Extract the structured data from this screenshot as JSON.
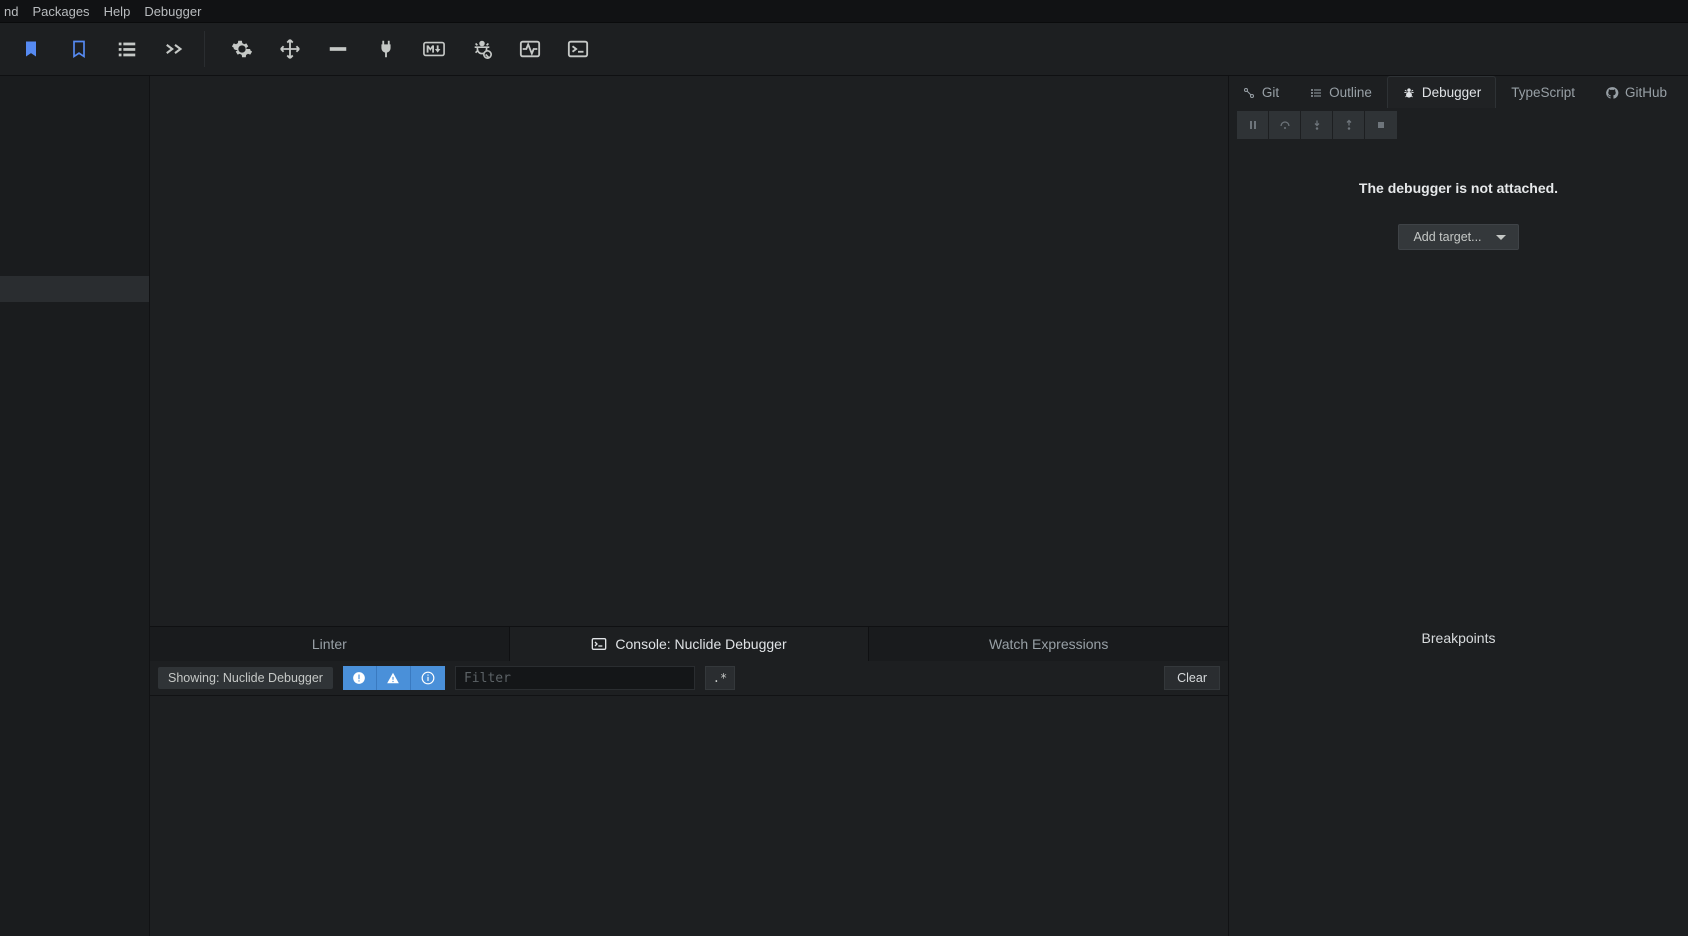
{
  "menubar": {
    "items": [
      "nd",
      "Packages",
      "Help",
      "Debugger"
    ]
  },
  "right_panel": {
    "tabs": [
      {
        "label": "Git",
        "active": false
      },
      {
        "label": "Outline",
        "active": false
      },
      {
        "label": "Debugger",
        "active": true
      },
      {
        "label": "TypeScript",
        "active": false
      },
      {
        "label": "GitHub",
        "active": false
      }
    ],
    "status_message": "The debugger is not attached.",
    "add_target_label": "Add target...",
    "breakpoints_header": "Breakpoints"
  },
  "bottom_panel": {
    "tabs": [
      {
        "label": "Linter",
        "active": false
      },
      {
        "label": "Console: Nuclide Debugger",
        "active": true
      },
      {
        "label": "Watch Expressions",
        "active": false
      }
    ],
    "showing_label": "Showing: Nuclide Debugger",
    "filter_placeholder": "Filter",
    "regex_label": ".*",
    "clear_label": "Clear"
  },
  "toolbar_icons": [
    "bookmark-filled-icon",
    "bookmark-outline-icon",
    "indent-icon",
    "prompt-icon",
    "gear-icon",
    "move-icon",
    "horizontal-rule-icon",
    "plug-icon",
    "markdown-icon",
    "bug-icon",
    "pulse-icon",
    "terminal-icon"
  ]
}
